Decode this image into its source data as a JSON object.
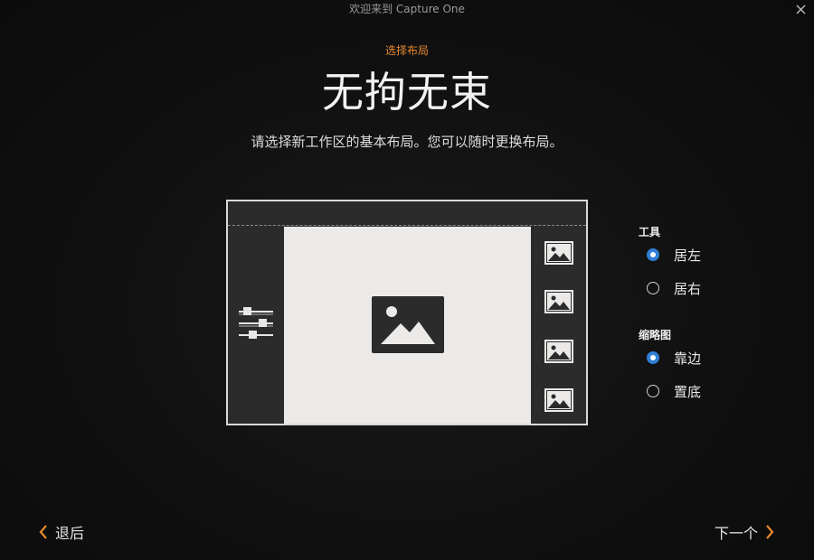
{
  "window": {
    "title": "欢迎来到 Capture One"
  },
  "wizard": {
    "step_label": "选择布局",
    "headline": "无拘无束",
    "subtitle": "请选择新工作区的基本布局。您可以随时更换布局。"
  },
  "options": {
    "tools": {
      "title": "工具",
      "items": [
        {
          "label": "居左",
          "checked": true
        },
        {
          "label": "居右",
          "checked": false
        }
      ]
    },
    "thumbnails": {
      "title": "缩略图",
      "items": [
        {
          "label": "靠边",
          "checked": true
        },
        {
          "label": "置底",
          "checked": false
        }
      ]
    }
  },
  "footer": {
    "back_label": "退后",
    "next_label": "下一个"
  },
  "colors": {
    "accent": "#e8892f",
    "radio_selected": "#2f7fd6",
    "background": "#0e0e0e"
  }
}
